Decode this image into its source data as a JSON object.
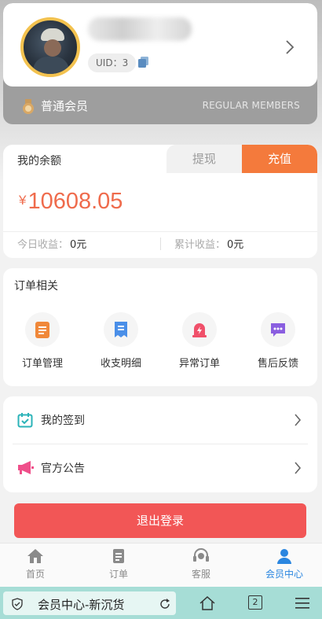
{
  "profile": {
    "uid_label": "UID：3",
    "level_name": "普通会员",
    "level_en": "REGULAR MEMBERS"
  },
  "balance": {
    "title": "我的余额",
    "withdraw_label": "提现",
    "recharge_label": "充值",
    "currency": "¥",
    "amount": "10608.05",
    "today_label": "今日收益：",
    "today_value": "0元",
    "total_label": "累计收益：",
    "total_value": "0元"
  },
  "orders": {
    "title": "订单相关",
    "items": [
      {
        "label": "订单管理",
        "icon": "clipboard-icon",
        "color": "#f0883a"
      },
      {
        "label": "收支明细",
        "icon": "receipt-icon",
        "color": "#4a8fe8"
      },
      {
        "label": "异常订单",
        "icon": "alarm-icon",
        "color": "#f0506a"
      },
      {
        "label": "售后反馈",
        "icon": "chat-icon",
        "color": "#8a5ee0"
      }
    ]
  },
  "links": [
    {
      "label": "我的签到",
      "icon": "calendar-check-icon"
    },
    {
      "label": "官方公告",
      "icon": "megaphone-icon"
    }
  ],
  "logout_label": "退出登录",
  "tabbar": [
    {
      "label": "首页",
      "icon": "home-icon",
      "active": false
    },
    {
      "label": "订单",
      "icon": "order-icon",
      "active": false
    },
    {
      "label": "客服",
      "icon": "headset-icon",
      "active": false
    },
    {
      "label": "会员中心",
      "icon": "user-icon",
      "active": true
    }
  ],
  "browser": {
    "page_title": "会员中心-新沉货",
    "tab_count": "2"
  },
  "colors": {
    "accent_orange": "#f47a3c",
    "amount_red": "#ef6b4c",
    "logout_red": "#f25656",
    "active_blue": "#2a86e0"
  }
}
